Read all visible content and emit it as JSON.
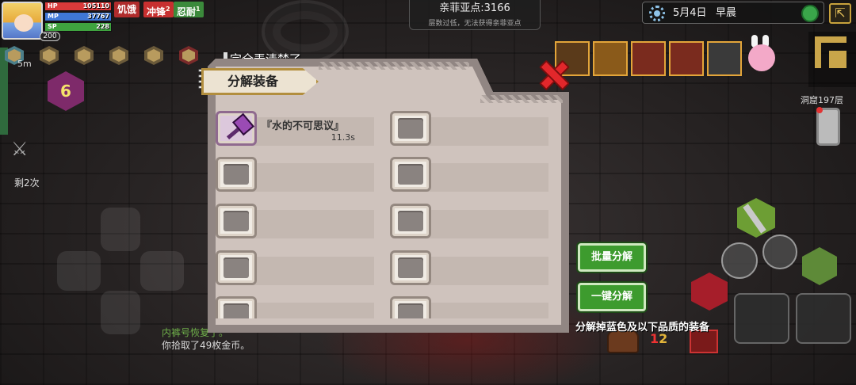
{
  "player": {
    "level": "200",
    "stats": [
      {
        "label": "HP",
        "value": "105110",
        "color": "#d93a3a",
        "fill": 1.0
      },
      {
        "label": "MP",
        "value": "37767",
        "color": "#3f77d6",
        "fill": 1.0
      },
      {
        "label": "SP",
        "value": "228",
        "color": "#3fa33f",
        "fill": 1.0
      }
    ],
    "status_tags": [
      {
        "text": "饥饿",
        "badge": "",
        "color": "#b02c2c"
      },
      {
        "text": "冲锋",
        "badge": "2",
        "color": "#c73030"
      },
      {
        "text": "忍耐",
        "badge": "1",
        "color": "#3b8a3b"
      }
    ],
    "buff_timer": "5m",
    "hex_level": "6",
    "remaining": "剩2次"
  },
  "hud": {
    "points": "亲菲亚点:3166",
    "points_note": "层数过低，无法获得亲菲亚点",
    "date": "5月4日",
    "time_of_day": "早晨",
    "cave_label": "洞窟197层"
  },
  "chat": {
    "line1": "内裤号恢复了。",
    "line2": "你拾取了49枚金币。"
  },
  "dialog": {
    "notice": "完全弄清楚了",
    "title": "分解装备",
    "slots": [
      {
        "filled": true,
        "name": "『水的不可思议』",
        "time": "11.3s"
      },
      {
        "filled": false,
        "name": "",
        "time": ""
      },
      {
        "filled": false,
        "name": "",
        "time": ""
      },
      {
        "filled": false,
        "name": "",
        "time": ""
      },
      {
        "filled": false,
        "name": "",
        "time": ""
      },
      {
        "filled": false,
        "name": "",
        "time": ""
      },
      {
        "filled": false,
        "name": "",
        "time": ""
      },
      {
        "filled": false,
        "name": "",
        "time": ""
      },
      {
        "filled": false,
        "name": "",
        "time": ""
      },
      {
        "filled": false,
        "name": "",
        "time": ""
      }
    ]
  },
  "actions": {
    "batch_label": "批量分解",
    "one_click_label": "一键分解",
    "hint": "分解掉蓝色及以下品质的装备"
  },
  "colors": {
    "button_green": "#3d9b2e",
    "close_red": "#e2272b",
    "dialog_bg": "#cfc3bd"
  }
}
